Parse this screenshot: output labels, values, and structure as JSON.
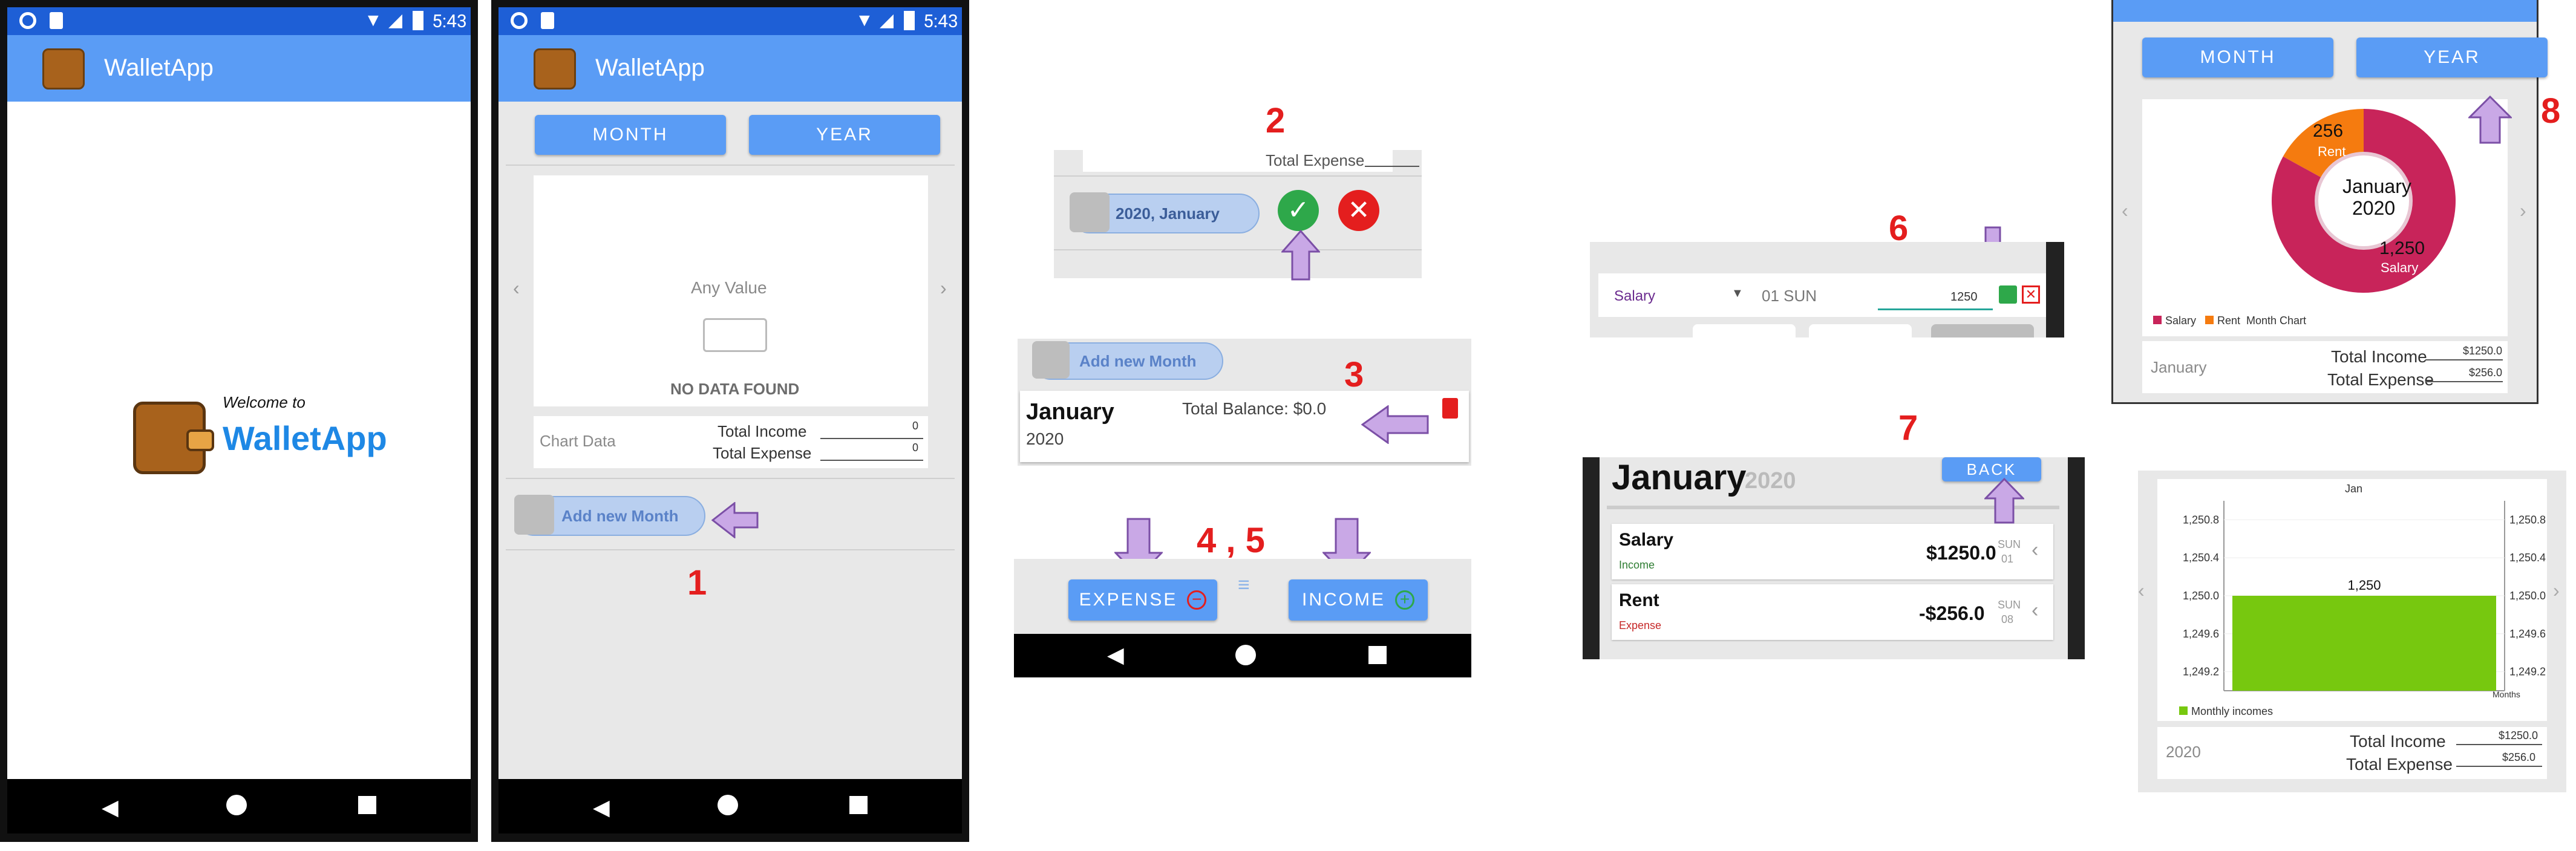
{
  "status": {
    "time": "5:43"
  },
  "app": {
    "title": "WalletApp"
  },
  "splash": {
    "welcome": "Welcome to",
    "name": "WalletApp"
  },
  "tabs": {
    "month": "MONTH",
    "year": "YEAR"
  },
  "screen1": {
    "any_value": "Any Value",
    "no_data": "NO DATA FOUND",
    "chart_data": "Chart Data",
    "total_income_label": "Total Income",
    "total_income_value": "0",
    "total_expense_label": "Total Expense",
    "total_expense_value": "0",
    "add_month": "Add new Month"
  },
  "steps": {
    "s1": "1",
    "s2": "2",
    "s3": "3",
    "s45": "4 , 5",
    "s6": "6",
    "s7": "7",
    "s8": "8"
  },
  "step2": {
    "total_expense": "Total Expense",
    "new_entry": "2020, January"
  },
  "step3": {
    "add_month": "Add new Month",
    "month": "January",
    "year": "2020",
    "balance": "Total Balance: $0.0"
  },
  "step45": {
    "expense": "EXPENSE",
    "income": "INCOME"
  },
  "step6": {
    "category": "Salary",
    "date": "01 SUN",
    "amount": "1250"
  },
  "step7": {
    "month": "January",
    "year": "2020",
    "back": "BACK",
    "items": [
      {
        "name": "Salary",
        "type": "Income",
        "amount": "$1250.0",
        "day": "SUN",
        "date": "01"
      },
      {
        "name": "Rent",
        "type": "Expense",
        "amount": "-$256.0",
        "day": "SUN",
        "date": "08"
      }
    ]
  },
  "step8": {
    "month": "MONTH",
    "year": "YEAR",
    "center_line1": "January",
    "center_line2": "2020",
    "label_rent_value": "256",
    "label_rent_name": "Rent",
    "label_salary_value": "1,250",
    "label_salary_name": "Salary",
    "legend_salary": "Salary",
    "legend_rent": "Rent",
    "legend_chart": "Month Chart",
    "footer_label": "January",
    "total_income_label": "Total Income",
    "total_income_value": "$1250.0",
    "total_expense_label": "Total Expense",
    "total_expense_value": "$256.0"
  },
  "bar": {
    "title": "Jan",
    "ticks": [
      "1,250.8",
      "1,250.4",
      "1,250.0",
      "1,249.6",
      "1,249.2"
    ],
    "bar_label": "1,250",
    "axis_unit": "Months",
    "legend": "Monthly incomes",
    "footer_label": "2020",
    "total_income_label": "Total Income",
    "total_income_value": "$1250.0",
    "total_expense_label": "Total Expense",
    "total_expense_value": "$256.0"
  },
  "chart_data": [
    {
      "type": "pie",
      "categories": [
        "Salary",
        "Rent"
      ],
      "values": [
        1250,
        256
      ],
      "title": ""
    },
    {
      "type": "bar",
      "categories": [
        "Jan"
      ],
      "values": [
        1250
      ],
      "title": "Jan",
      "ylim": [
        1249.0,
        1251.0
      ],
      "series": [
        {
          "name": "Monthly incomes",
          "values": [
            1250
          ]
        }
      ]
    }
  ],
  "colors": {
    "statusbar": "#1e5fd6",
    "appbar": "#5a9cf5",
    "salary": "#c8245a",
    "rent": "#f57b0f",
    "bar": "#77c80f",
    "step": "#e41e1e",
    "arrow": "#c9a8e6"
  }
}
